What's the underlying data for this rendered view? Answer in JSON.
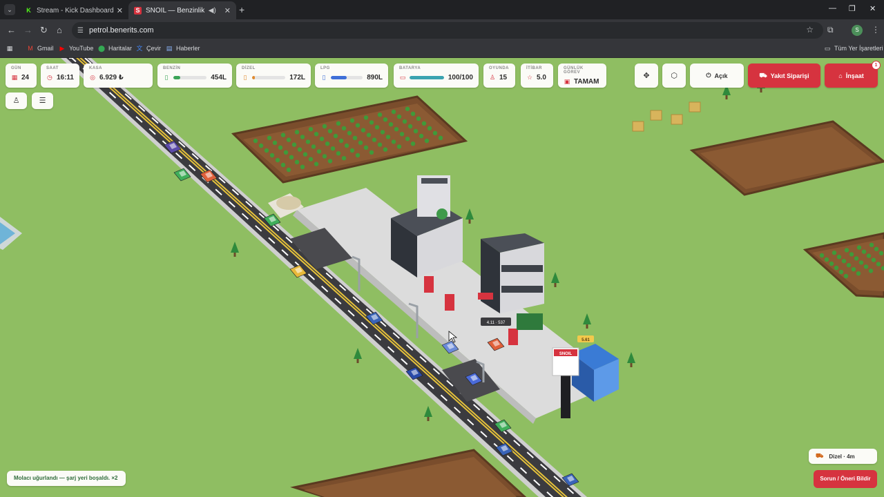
{
  "browser": {
    "tabs": [
      {
        "title": "Stream - Kick Dashboard",
        "favicon": "kick-icon"
      },
      {
        "title": "SNOIL — Benzinlik",
        "favicon": "snoil-icon",
        "active": true
      }
    ],
    "url": "petrol.benerits.com",
    "profile_initial": "S",
    "bookmarks": [
      {
        "label": "Gmail",
        "icon": "gmail-icon"
      },
      {
        "label": "YouTube",
        "icon": "youtube-icon"
      },
      {
        "label": "Haritalar",
        "icon": "maps-icon"
      },
      {
        "label": "Çevir",
        "icon": "translate-icon"
      },
      {
        "label": "Haberler",
        "icon": "news-icon"
      }
    ],
    "all_bookmarks": "Tüm Yer İşaretleri"
  },
  "hud": {
    "day": {
      "label": "GÜN",
      "value": "24"
    },
    "time": {
      "label": "SAAT",
      "value": "16:11"
    },
    "cash": {
      "label": "KASA",
      "value": "6.929 ₺"
    },
    "gasoline": {
      "label": "BENZİN",
      "value": "454L",
      "level": 0.2,
      "color": "#3aa457"
    },
    "diesel": {
      "label": "DİZEL",
      "value": "172L",
      "level": 0.08,
      "color": "#e08a2e"
    },
    "lpg": {
      "label": "LPG",
      "value": "890L",
      "level": 0.5,
      "color": "#3f6fd8"
    },
    "battery": {
      "label": "BATARYA",
      "value": "100/100",
      "level": 1.0,
      "color": "#3aa3b0"
    },
    "playing": {
      "label": "OYUNDA",
      "value": "15"
    },
    "reputation": {
      "label": "İTİBAR",
      "value": "5.0"
    },
    "daily_task": {
      "label": "GÜNLÜK GÖREV",
      "value": "TAMAM"
    }
  },
  "controls": {
    "open_label": "Açık",
    "fuel_order_label": "Yakıt Siparişi",
    "build_label": "İnşaat",
    "build_badge": "1"
  },
  "scene": {
    "station_sign": "SNOIL",
    "price_tag": "4.11 · 537",
    "cost_tag": "5.61"
  },
  "toast": "Molacı uğurlandı — şarj yeri boşaldı. ×2",
  "pending_order": "Dizel · 4m",
  "feedback_label": "Sorun / Öneri Bildir"
}
